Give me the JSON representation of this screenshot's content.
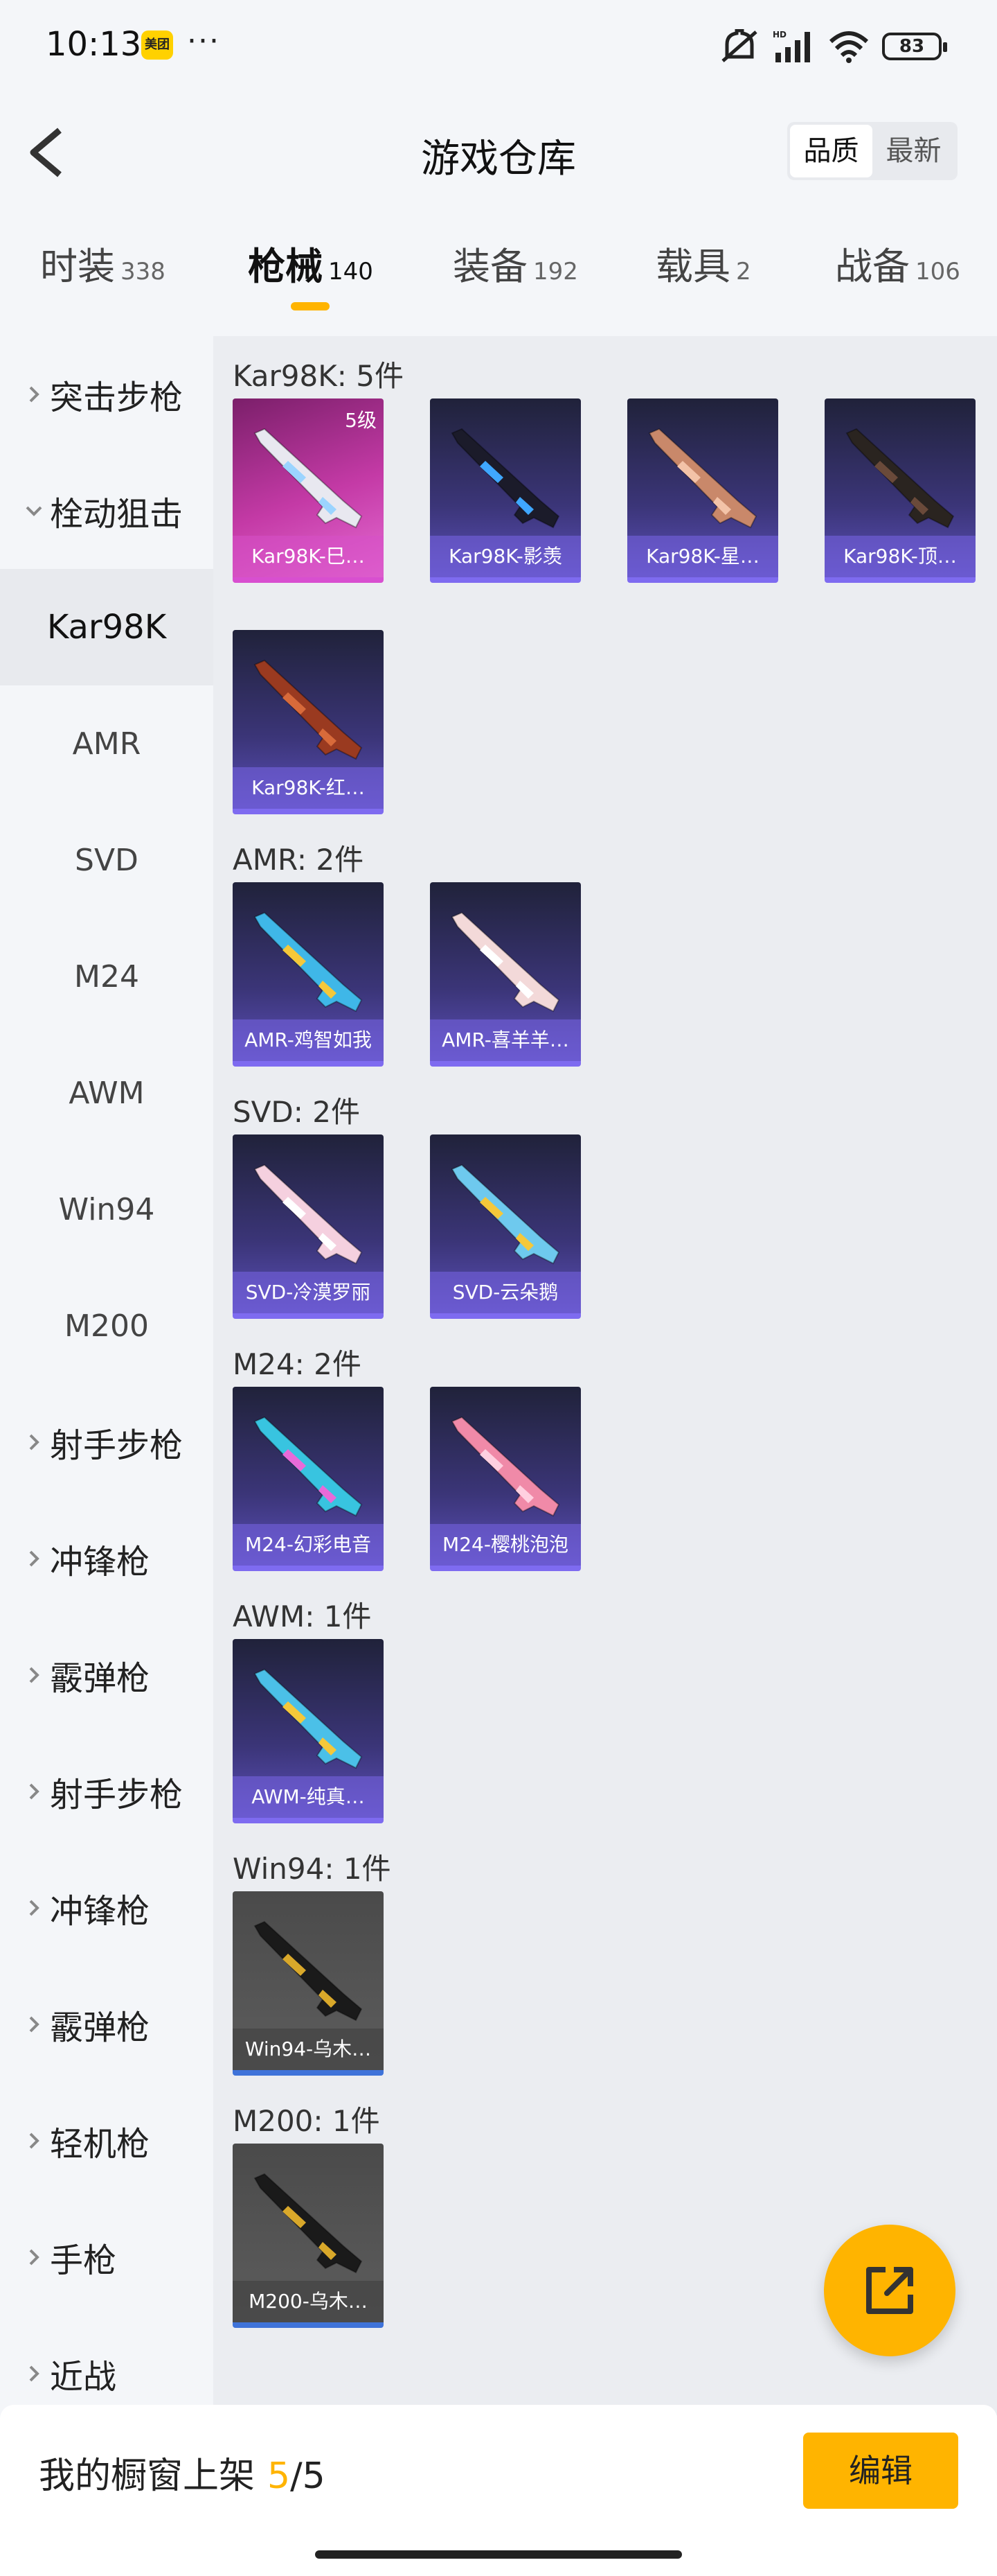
{
  "status_bar": {
    "time": "10:13",
    "app_badge": "美团",
    "more": "···",
    "battery": "83",
    "hd_label": "HD"
  },
  "header": {
    "title": "游戏仓库",
    "sort_options": [
      "品质",
      "最新"
    ],
    "sort_selected": "品质"
  },
  "tabs": [
    {
      "label": "时装",
      "count": "338"
    },
    {
      "label": "枪械",
      "count": "140",
      "active": true
    },
    {
      "label": "装备",
      "count": "192"
    },
    {
      "label": "载具",
      "count": "2"
    },
    {
      "label": "战备",
      "count": "106"
    }
  ],
  "sidebar": [
    {
      "label": "突击步枪",
      "type": "group",
      "expanded": false
    },
    {
      "label": "栓动狙击",
      "type": "group",
      "expanded": true
    },
    {
      "label": "Kar98K",
      "type": "sub",
      "selected": true
    },
    {
      "label": "AMR",
      "type": "sub"
    },
    {
      "label": "SVD",
      "type": "sub"
    },
    {
      "label": "M24",
      "type": "sub"
    },
    {
      "label": "AWM",
      "type": "sub"
    },
    {
      "label": "Win94",
      "type": "sub"
    },
    {
      "label": "M200",
      "type": "sub"
    },
    {
      "label": "射手步枪",
      "type": "group",
      "expanded": false
    },
    {
      "label": "冲锋枪",
      "type": "group",
      "expanded": false
    },
    {
      "label": "霰弹枪",
      "type": "group",
      "expanded": false
    },
    {
      "label": "射手步枪",
      "type": "group",
      "expanded": false
    },
    {
      "label": "冲锋枪",
      "type": "group",
      "expanded": false
    },
    {
      "label": "霰弹枪",
      "type": "group",
      "expanded": false
    },
    {
      "label": "轻机枪",
      "type": "group",
      "expanded": false
    },
    {
      "label": "手枪",
      "type": "group",
      "expanded": false
    },
    {
      "label": "近战",
      "type": "group",
      "expanded": false
    }
  ],
  "sections": [
    {
      "title": "Kar98K: 5件",
      "items": [
        {
          "name": "Kar98K-巳…",
          "level": "5级",
          "style": "pink",
          "gun_color": "#e8e8f0",
          "accent": "#9bd4ff"
        },
        {
          "name": "Kar98K-影羡",
          "style": "purple",
          "gun_color": "#1b1b2a",
          "accent": "#3fa7ff"
        },
        {
          "name": "Kar98K-星…",
          "style": "purple",
          "gun_color": "#c9886a",
          "accent": "#f3c3a8"
        },
        {
          "name": "Kar98K-顶…",
          "style": "purple",
          "gun_color": "#2a2420",
          "accent": "#6a4a3a"
        },
        {
          "name": "Kar98K-红…",
          "style": "purple",
          "gun_color": "#9a3a20",
          "accent": "#d86a3a"
        }
      ]
    },
    {
      "title": "AMR: 2件",
      "items": [
        {
          "name": "AMR-鸡智如我",
          "style": "purple",
          "gun_color": "#3fb7e8",
          "accent": "#f5c83a"
        },
        {
          "name": "AMR-喜羊羊…",
          "style": "purple",
          "gun_color": "#f3d9d9",
          "accent": "#ffffff"
        }
      ]
    },
    {
      "title": "SVD: 2件",
      "items": [
        {
          "name": "SVD-冷漠罗丽",
          "style": "purple",
          "gun_color": "#f5d0df",
          "accent": "#ffffff"
        },
        {
          "name": "SVD-云朵鹅",
          "style": "purple",
          "gun_color": "#6ec9ee",
          "accent": "#f5c83a"
        }
      ]
    },
    {
      "title": "M24: 2件",
      "items": [
        {
          "name": "M24-幻彩电音",
          "style": "purple",
          "gun_color": "#38c4e0",
          "accent": "#e86ad8"
        },
        {
          "name": "M24-樱桃泡泡",
          "style": "purple",
          "gun_color": "#f08aa8",
          "accent": "#ffd0e0"
        }
      ]
    },
    {
      "title": "AWM: 1件",
      "items": [
        {
          "name": "AWM-纯真…",
          "style": "purple",
          "gun_color": "#4bc0e8",
          "accent": "#f5c83a"
        }
      ]
    },
    {
      "title": "Win94: 1件",
      "items": [
        {
          "name": "Win94-乌木…",
          "style": "grey",
          "gun_color": "#1a1a1a",
          "accent": "#d9a82a"
        }
      ]
    },
    {
      "title": "M200: 1件",
      "items": [
        {
          "name": "M200-乌木…",
          "style": "grey",
          "gun_color": "#1a1a1a",
          "accent": "#d9a82a"
        }
      ]
    }
  ],
  "bottom_bar": {
    "label": "我的橱窗上架",
    "used": "5",
    "total": "/5",
    "edit_label": "编辑"
  },
  "colors": {
    "accent": "#ffb400",
    "card_purple": "#3b3578",
    "card_pink": "#c43aa6"
  }
}
